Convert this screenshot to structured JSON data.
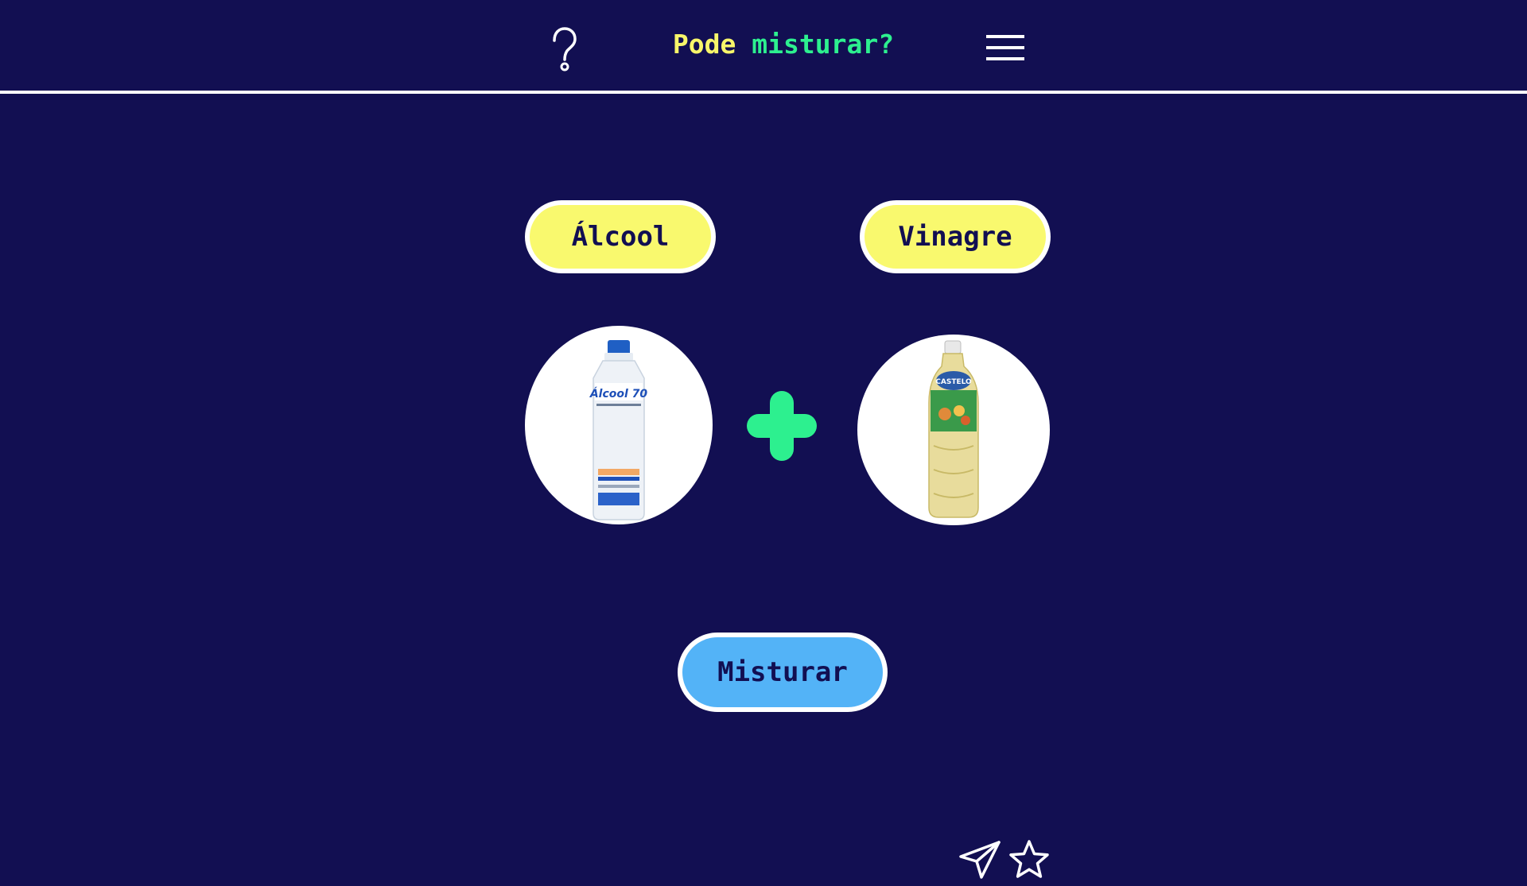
{
  "header": {
    "title_part1": "Pode",
    "title_part2": "misturar?",
    "help_icon": "question-mark-icon",
    "menu_icon": "hamburger-menu-icon"
  },
  "items": [
    {
      "label": "Álcool",
      "image": "alcohol-bottle-image"
    },
    {
      "label": "Vinagre",
      "image": "vinegar-bottle-image"
    }
  ],
  "combine_icon": "plus-icon",
  "action": {
    "mix_label": "Misturar"
  },
  "footer": {
    "share_icon": "paper-plane-icon",
    "favorite_icon": "star-icon"
  },
  "colors": {
    "background": "#120f52",
    "title_yellow": "#f8f66a",
    "title_green": "#2df08f",
    "pill_yellow": "#f9f96e",
    "button_blue": "#53b3f7",
    "plus_green": "#2df08f"
  }
}
